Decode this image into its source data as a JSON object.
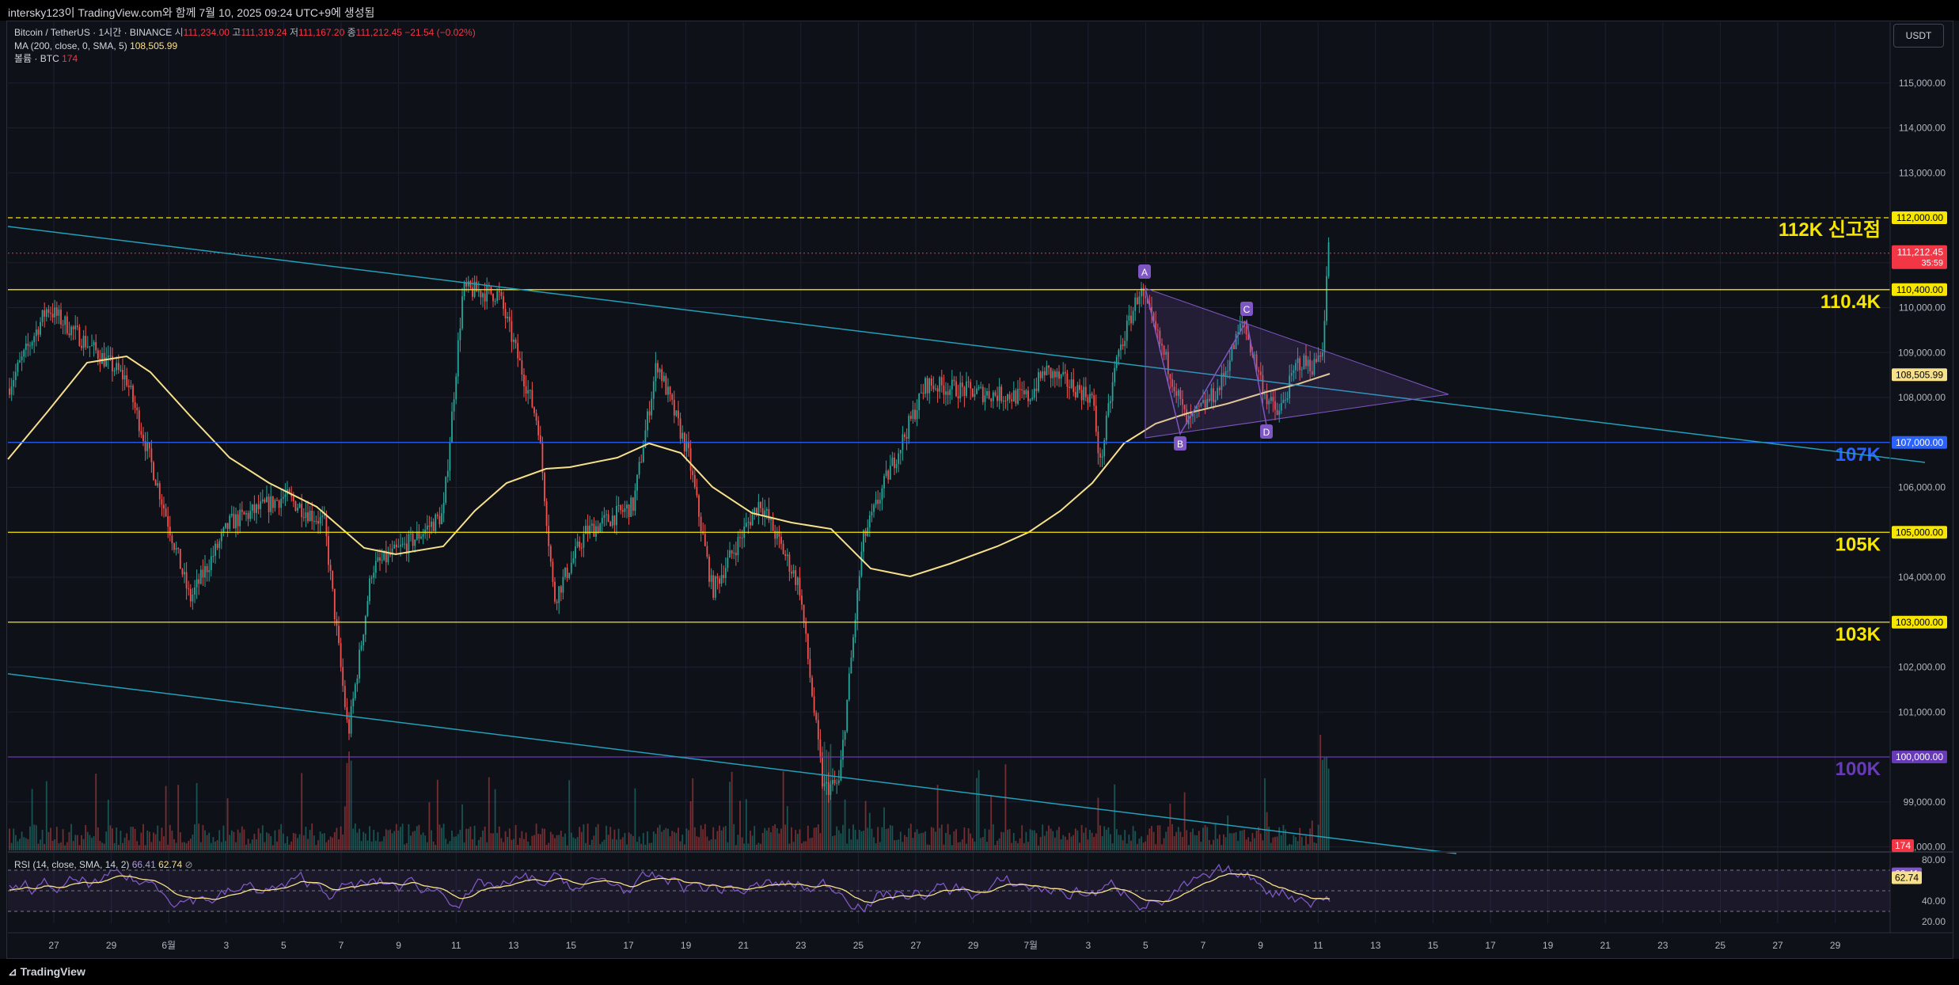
{
  "header": {
    "caption": "intersky123이 TradingView.com와 함께 7월 10, 2025 09:24 UTC+9에 생성됨"
  },
  "legend": {
    "symbol": "Bitcoin / TetherUS · 1시간 · BINANCE",
    "o_label": "시",
    "o_value": "111,234.00",
    "h_label": "고",
    "h_value": "111,319.24",
    "l_label": "저",
    "l_value": "111,167.20",
    "c_label": "종",
    "c_value": "111,212.45",
    "change": "−21.54 (−0.02%)",
    "ma_label": "MA (200, close, 0, SMA, 5)",
    "ma_value": "108,505.99",
    "vol_label": "볼륨 · BTC",
    "vol_value": "174",
    "rsi_label": "RSI (14, close, SMA, 14, 2)",
    "rsi_value": "66.41",
    "rsi_ma_value": "62.74",
    "rsi_icon": "eye-off-icon"
  },
  "currency_button": "USDT",
  "price_axis": {
    "ticks": [
      {
        "value": 115000,
        "label": "115,000.00"
      },
      {
        "value": 114000,
        "label": "114,000.00"
      },
      {
        "value": 113000,
        "label": "113,000.00"
      },
      {
        "value": 112000,
        "label": "112,000.00"
      },
      {
        "value": 111000,
        "label": "111,000.00"
      },
      {
        "value": 110000,
        "label": "110,000.00"
      },
      {
        "value": 109000,
        "label": "109,000.00"
      },
      {
        "value": 108000,
        "label": "108,000.00"
      },
      {
        "value": 107000,
        "label": "107,000.00"
      },
      {
        "value": 106000,
        "label": "106,000.00"
      },
      {
        "value": 105000,
        "label": "105,000.00"
      },
      {
        "value": 104000,
        "label": "104,000.00"
      },
      {
        "value": 103000,
        "label": "103,000.00"
      },
      {
        "value": 102000,
        "label": "102,000.00"
      },
      {
        "value": 101000,
        "label": "101,000.00"
      },
      {
        "value": 100000,
        "label": "100,000.00"
      },
      {
        "value": 99000,
        "label": "99,000.00"
      },
      {
        "value": 98000,
        "label": "98,000.00"
      }
    ],
    "badges": [
      {
        "value": 112000,
        "label": "112,000.00",
        "bg": "#f7e600",
        "fg": "#000000"
      },
      {
        "value": 110400,
        "label": "110,400.00",
        "bg": "#f7e600",
        "fg": "#000000"
      },
      {
        "value": 108506,
        "label": "108,505.99",
        "bg": "#f7e08b",
        "fg": "#000000"
      },
      {
        "value": 107000,
        "label": "107,000.00",
        "bg": "#2962ff",
        "fg": "#ffffff"
      },
      {
        "value": 105000,
        "label": "105,000.00",
        "bg": "#f7e600",
        "fg": "#000000"
      },
      {
        "value": 103000,
        "label": "103,000.00",
        "bg": "#f7e600",
        "fg": "#000000"
      },
      {
        "value": 100000,
        "label": "100,000.00",
        "bg": "#673ab7",
        "fg": "#ffffff"
      }
    ],
    "last_price": {
      "value": 111212.45,
      "label": "111,212.45",
      "countdown": "35:59",
      "bg": "#f23645"
    },
    "volume_badge": "174"
  },
  "level_labels": [
    {
      "value": 112000,
      "text": "112K 신고점",
      "color": "#f7e600",
      "dashed": true
    },
    {
      "value": 110400,
      "text": "110.4K",
      "color": "#f7e600",
      "dashed": false
    },
    {
      "value": 107000,
      "text": "107K",
      "color": "#2962ff",
      "dashed": false
    },
    {
      "value": 105000,
      "text": "105K",
      "color": "#f7e600",
      "dashed": false
    },
    {
      "value": 103000,
      "text": "103K",
      "color": "#f7e600",
      "dashed": false
    },
    {
      "value": 100000,
      "text": "100K",
      "color": "#673ab7",
      "dashed": false
    }
  ],
  "rsi_axis": {
    "ticks": [
      {
        "value": 80,
        "label": "80.00"
      },
      {
        "value": 40,
        "label": "40.00"
      },
      {
        "value": 20,
        "label": "20.00"
      }
    ],
    "badges": [
      {
        "value": 66.41,
        "label": "66.41",
        "bg": "#7e57c2",
        "fg": "#ffffff"
      },
      {
        "value": 62.74,
        "label": "62.74",
        "bg": "#f7e08b",
        "fg": "#000000"
      }
    ]
  },
  "time_axis": {
    "labels": [
      "27",
      "29",
      "6월",
      "3",
      "5",
      "7",
      "9",
      "11",
      "13",
      "15",
      "17",
      "19",
      "21",
      "23",
      "25",
      "27",
      "29",
      "7월",
      "3",
      "5",
      "7",
      "9",
      "11",
      "13",
      "15",
      "17",
      "19",
      "21",
      "23",
      "25",
      "27",
      "29"
    ]
  },
  "pattern_points": [
    "A",
    "B",
    "C",
    "D"
  ],
  "footer": {
    "logo_text": "TradingView"
  },
  "colors": {
    "up": "#26a69a",
    "down": "#ef5350",
    "ma": "#f7e08b",
    "trend": "#22a0b8",
    "rsi": "#7e57c2",
    "grid": "#1c2030"
  }
}
